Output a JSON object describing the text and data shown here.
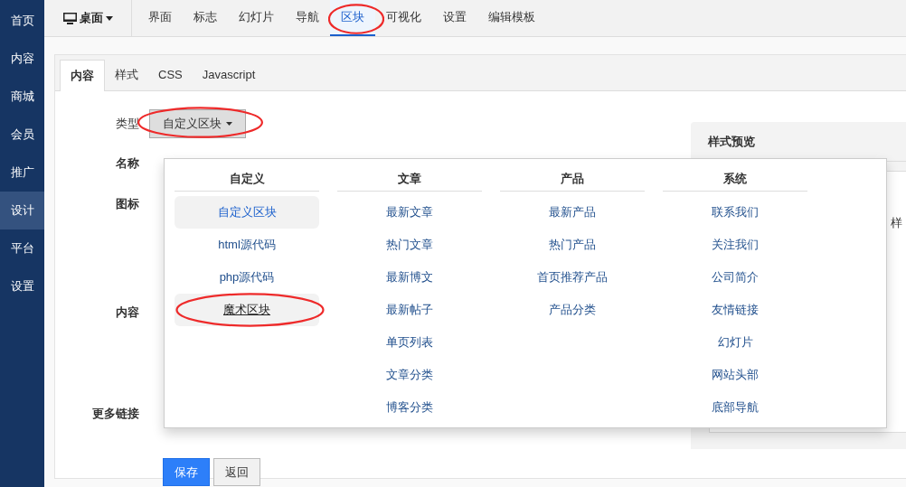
{
  "sidebar": {
    "items": [
      {
        "label": "首页",
        "selected": false
      },
      {
        "label": "内容",
        "selected": false
      },
      {
        "label": "商城",
        "selected": false
      },
      {
        "label": "会员",
        "selected": false
      },
      {
        "label": "推广",
        "selected": false
      },
      {
        "label": "设计",
        "selected": true
      },
      {
        "label": "平台",
        "selected": false
      },
      {
        "label": "设置",
        "selected": false
      }
    ]
  },
  "top_bar": {
    "device": "桌面",
    "items": [
      {
        "label": "界面",
        "selected": false,
        "circled": false
      },
      {
        "label": "标志",
        "selected": false,
        "circled": false
      },
      {
        "label": "幻灯片",
        "selected": false,
        "circled": false
      },
      {
        "label": "导航",
        "selected": false,
        "circled": false
      },
      {
        "label": "区块",
        "selected": true,
        "circled": true
      },
      {
        "label": "可视化",
        "selected": false,
        "circled": false
      },
      {
        "label": "设置",
        "selected": false,
        "circled": false
      },
      {
        "label": "编辑模板",
        "selected": false,
        "circled": false
      }
    ]
  },
  "tabs": [
    {
      "label": "内容",
      "selected": true
    },
    {
      "label": "样式",
      "selected": false
    },
    {
      "label": "CSS",
      "selected": false
    },
    {
      "label": "Javascript",
      "selected": false
    }
  ],
  "form": {
    "type_label": "类型",
    "type_value": "自定义区块",
    "type_circled": true,
    "labels": [
      "名称",
      "图标",
      "内容",
      "更多链接"
    ]
  },
  "dropdown": {
    "columns": [
      {
        "heading": "自定义",
        "items": [
          {
            "label": "自定义区块",
            "selected": true,
            "highlighted": false,
            "circled": false
          },
          {
            "label": "html源代码",
            "selected": false,
            "highlighted": false,
            "circled": false
          },
          {
            "label": "php源代码",
            "selected": false,
            "highlighted": false,
            "circled": false
          },
          {
            "label": "魔术区块",
            "selected": false,
            "highlighted": true,
            "circled": true
          }
        ]
      },
      {
        "heading": "文章",
        "items": [
          {
            "label": "最新文章",
            "selected": false,
            "highlighted": false,
            "circled": false
          },
          {
            "label": "热门文章",
            "selected": false,
            "highlighted": false,
            "circled": false
          },
          {
            "label": "最新博文",
            "selected": false,
            "highlighted": false,
            "circled": false
          },
          {
            "label": "最新帖子",
            "selected": false,
            "highlighted": false,
            "circled": false
          },
          {
            "label": "单页列表",
            "selected": false,
            "highlighted": false,
            "circled": false
          },
          {
            "label": "文章分类",
            "selected": false,
            "highlighted": false,
            "circled": false
          },
          {
            "label": "博客分类",
            "selected": false,
            "highlighted": false,
            "circled": false
          }
        ]
      },
      {
        "heading": "产品",
        "items": [
          {
            "label": "最新产品",
            "selected": false,
            "highlighted": false,
            "circled": false
          },
          {
            "label": "热门产品",
            "selected": false,
            "highlighted": false,
            "circled": false
          },
          {
            "label": "首页推荐产品",
            "selected": false,
            "highlighted": false,
            "circled": false
          },
          {
            "label": "产品分类",
            "selected": false,
            "highlighted": false,
            "circled": false
          }
        ]
      },
      {
        "heading": "系统",
        "items": [
          {
            "label": "联系我们",
            "selected": false,
            "highlighted": false,
            "circled": false
          },
          {
            "label": "关注我们",
            "selected": false,
            "highlighted": false,
            "circled": false
          },
          {
            "label": "公司简介",
            "selected": false,
            "highlighted": false,
            "circled": false
          },
          {
            "label": "友情链接",
            "selected": false,
            "highlighted": false,
            "circled": false
          },
          {
            "label": "幻灯片",
            "selected": false,
            "highlighted": false,
            "circled": false
          },
          {
            "label": "网站头部",
            "selected": false,
            "highlighted": false,
            "circled": false
          },
          {
            "label": "底部导航",
            "selected": false,
            "highlighted": false,
            "circled": false
          }
        ]
      }
    ]
  },
  "preview": {
    "title": "样式预览",
    "partial_text": "样"
  },
  "buttons": [
    {
      "label": "保存",
      "kind": "primary"
    },
    {
      "label": "返回",
      "kind": "default"
    }
  ]
}
